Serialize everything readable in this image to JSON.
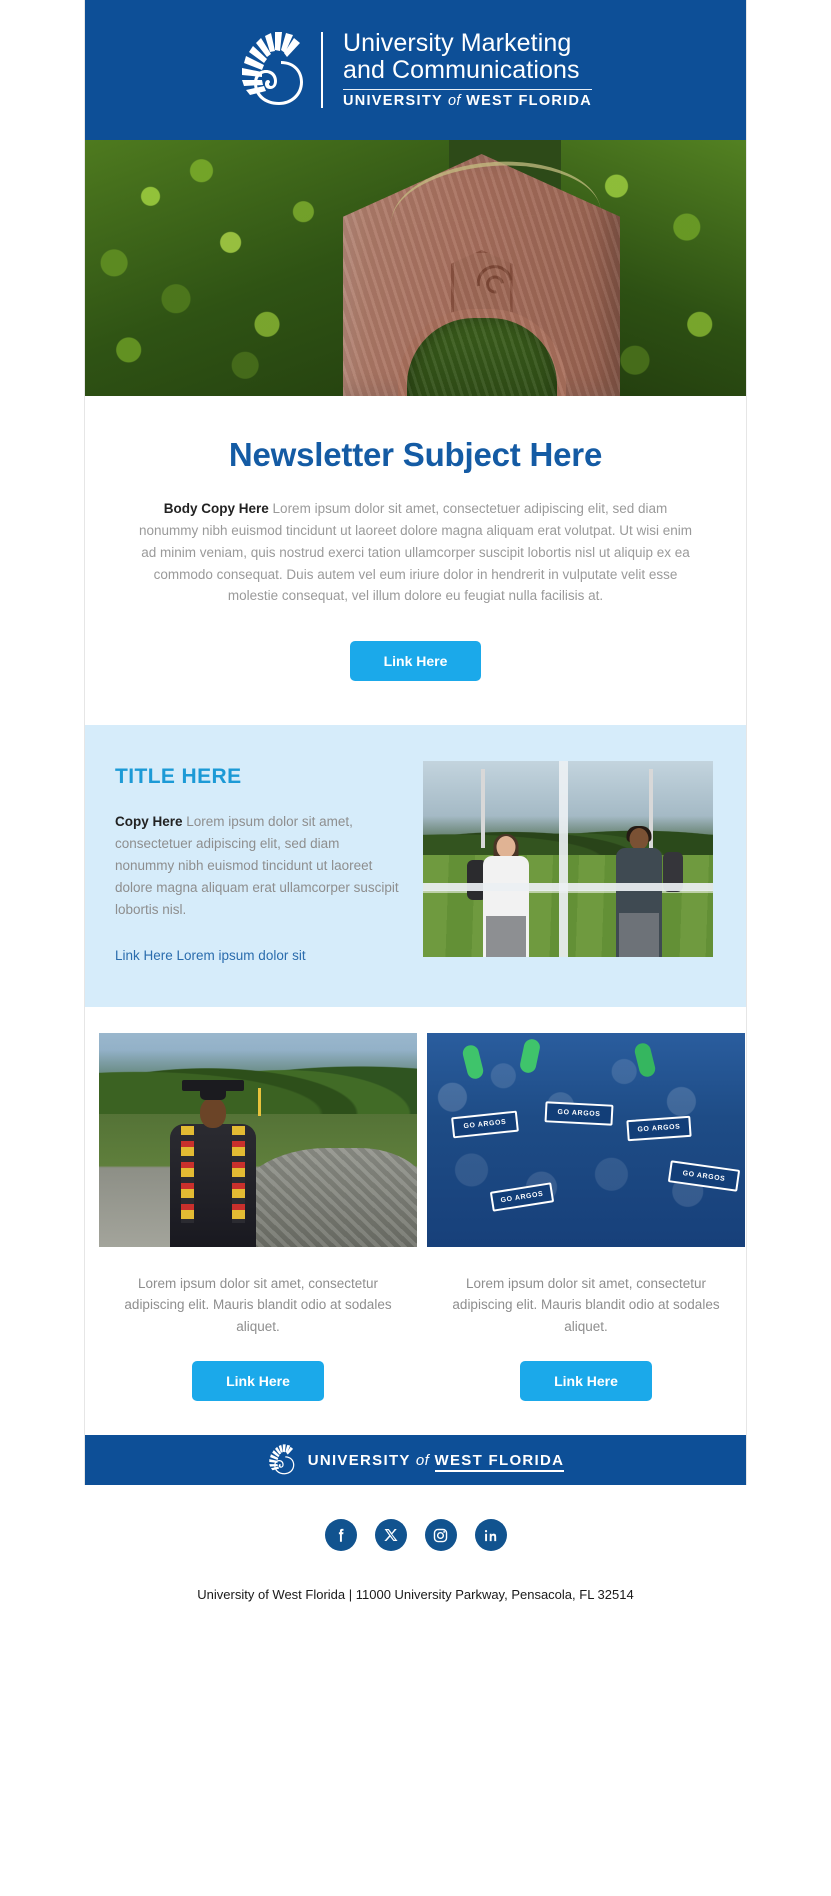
{
  "brand": {
    "header_blue": "#0d4f97",
    "cta_cyan": "#1ba9ea",
    "title_blue": "#145ba4",
    "feature_bg": "#d6ecfa",
    "feature_title_cyan": "#1c9ad6",
    "link_blue": "#2a6cad"
  },
  "header": {
    "logo_line1": "University Marketing",
    "logo_line2": "and Communications",
    "logo_university": "UNIVERSITY",
    "logo_of": "of",
    "logo_west_florida": "WEST FLORIDA"
  },
  "hero": {
    "alt": "Brick archway monument with nautilus crest surrounded by green foliage"
  },
  "intro": {
    "title": "Newsletter Subject Here",
    "lead": "Body Copy Here",
    "copy": " Lorem ipsum dolor sit amet, consectetuer adipiscing elit, sed diam nonummy nibh euismod tincidunt ut laoreet dolore magna aliquam erat volutpat. Ut wisi enim ad minim veniam, quis nostrud exerci tation ullamcorper suscipit lobortis nisl ut aliquip ex ea commodo consequat. Duis autem vel eum iriure dolor in hendrerit in vulputate velit esse molestie consequat, vel illum dolore eu feugiat nulla facilisis at.",
    "button_label": "Link Here"
  },
  "feature": {
    "title": "TITLE HERE",
    "lead": "Copy Here",
    "copy": " Lorem ipsum dolor sit amet, consectetuer adipiscing elit, sed diam nonummy nibh euismod tincidunt ut laoreet dolore magna aliquam erat ullamcorper suscipit lobortis nisl.",
    "link_label": "Link Here Lorem ipsum dolor sit",
    "photo_alt": "Two students with backpacks standing by a football field"
  },
  "columns": [
    {
      "photo_alt": "Graduate in cap and gown with yellow stole standing outdoors",
      "caption": "Lorem ipsum dolor sit amet, consectetur adipiscing elit. Mauris blandit odio at sodales aliquet.",
      "button_label": "Link Here"
    },
    {
      "photo_alt": "Student crowd cheering with GO ARGOS signs",
      "caption": "Lorem ipsum dolor sit amet, consectetur adipiscing elit. Mauris blandit odio at sodales aliquet.",
      "button_label": "Link Here",
      "sign_text": "GO ARGOS"
    }
  ],
  "footer": {
    "university": "UNIVERSITY",
    "of": "of",
    "west_florida": "WEST FLORIDA",
    "social": [
      {
        "name": "facebook",
        "glyph": "f"
      },
      {
        "name": "x-twitter",
        "glyph": "𝕏"
      },
      {
        "name": "instagram",
        "glyph": "◎"
      },
      {
        "name": "linkedin",
        "glyph": "in"
      }
    ],
    "address": "University of West Florida  |  11000 University Parkway, Pensacola, FL 32514"
  }
}
